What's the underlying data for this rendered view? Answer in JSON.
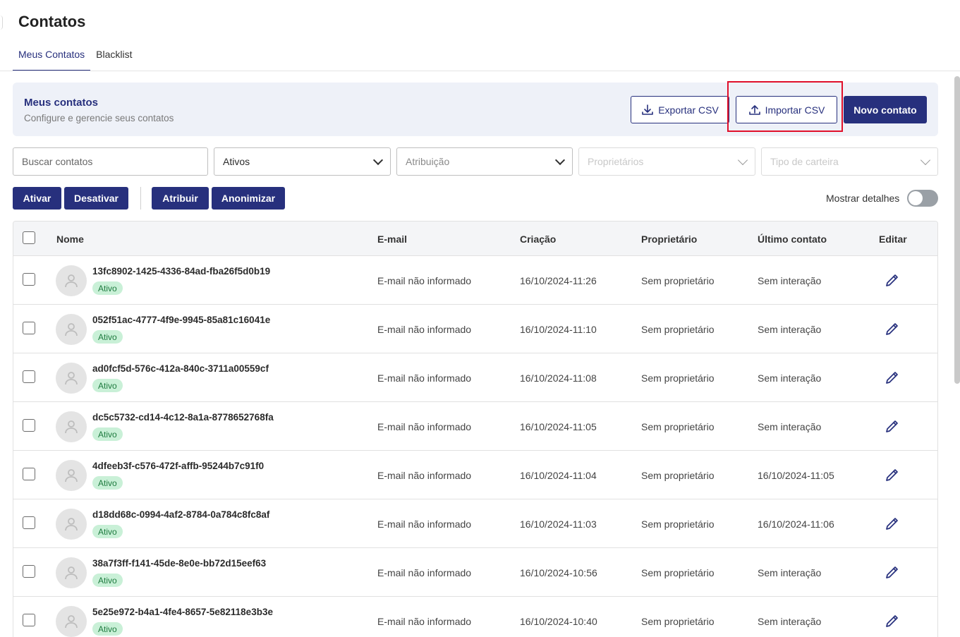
{
  "page": {
    "title": "Contatos"
  },
  "tabs": [
    {
      "label": "Meus Contatos",
      "active": true
    },
    {
      "label": "Blacklist",
      "active": false
    }
  ],
  "header": {
    "title": "Meus contatos",
    "subtitle": "Configure e gerencie seus contatos",
    "export_label": "Exportar CSV",
    "import_label": "Importar CSV",
    "new_label": "Novo contato"
  },
  "filters": {
    "search_placeholder": "Buscar contatos",
    "status_value": "Ativos",
    "assignment_placeholder": "Atribuição",
    "owners_placeholder": "Proprietários",
    "wallet_placeholder": "Tipo de carteira"
  },
  "actions": {
    "activate": "Ativar",
    "deactivate": "Desativar",
    "assign": "Atribuir",
    "anonymize": "Anonimizar",
    "show_details": "Mostrar detalhes"
  },
  "table": {
    "columns": {
      "name": "Nome",
      "email": "E-mail",
      "created": "Criação",
      "owner": "Proprietário",
      "last_contact": "Último contato",
      "edit": "Editar"
    },
    "rows": [
      {
        "name": "13fc8902-1425-4336-84ad-fba26f5d0b19",
        "status": "Ativo",
        "email": "E-mail não informado",
        "created": "16/10/2024-11:26",
        "owner": "Sem proprietário",
        "last_contact": "Sem interação"
      },
      {
        "name": "052f51ac-4777-4f9e-9945-85a81c16041e",
        "status": "Ativo",
        "email": "E-mail não informado",
        "created": "16/10/2024-11:10",
        "owner": "Sem proprietário",
        "last_contact": "Sem interação"
      },
      {
        "name": "ad0fcf5d-576c-412a-840c-3711a00559cf",
        "status": "Ativo",
        "email": "E-mail não informado",
        "created": "16/10/2024-11:08",
        "owner": "Sem proprietário",
        "last_contact": "Sem interação"
      },
      {
        "name": "dc5c5732-cd14-4c12-8a1a-8778652768fa",
        "status": "Ativo",
        "email": "E-mail não informado",
        "created": "16/10/2024-11:05",
        "owner": "Sem proprietário",
        "last_contact": "Sem interação"
      },
      {
        "name": "4dfeeb3f-c576-472f-affb-95244b7c91f0",
        "status": "Ativo",
        "email": "E-mail não informado",
        "created": "16/10/2024-11:04",
        "owner": "Sem proprietário",
        "last_contact": "16/10/2024-11:05"
      },
      {
        "name": "d18dd68c-0994-4af2-8784-0a784c8fc8af",
        "status": "Ativo",
        "email": "E-mail não informado",
        "created": "16/10/2024-11:03",
        "owner": "Sem proprietário",
        "last_contact": "16/10/2024-11:06"
      },
      {
        "name": "38a7f3ff-f141-45de-8e0e-bb72d15eef63",
        "status": "Ativo",
        "email": "E-mail não informado",
        "created": "16/10/2024-10:56",
        "owner": "Sem proprietário",
        "last_contact": "Sem interação"
      },
      {
        "name": "5e25e972-b4a1-4fe4-8657-5e82118e3b3e",
        "status": "Ativo",
        "email": "E-mail não informado",
        "created": "16/10/2024-10:40",
        "owner": "Sem proprietário",
        "last_contact": "Sem interação"
      }
    ]
  }
}
